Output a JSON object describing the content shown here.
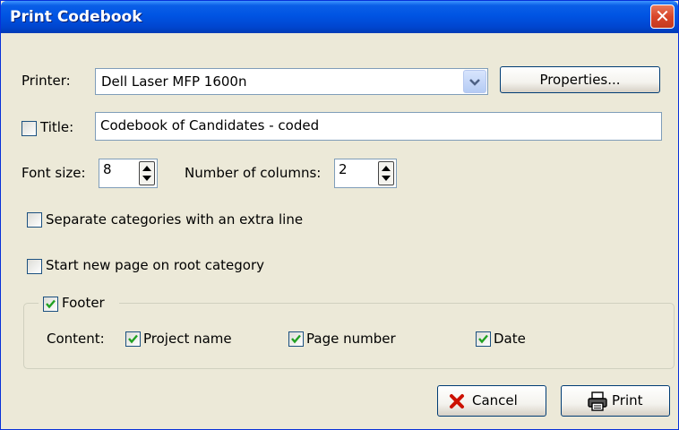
{
  "window": {
    "title": "Print Codebook"
  },
  "printer": {
    "label": "Printer:",
    "selected": "Dell Laser MFP 1600n",
    "properties_label": "Properties..."
  },
  "title_field": {
    "label": "Title:",
    "checked": false,
    "value": "Codebook of Candidates - coded"
  },
  "font_size": {
    "label": "Font size:",
    "value": "8"
  },
  "columns": {
    "label": "Number of columns:",
    "value": "2"
  },
  "options": {
    "separate_label": "Separate categories with an extra line",
    "separate_checked": false,
    "newpage_label": "Start new page on root category",
    "newpage_checked": false
  },
  "footer": {
    "label": "Footer",
    "checked": true,
    "content_label": "Content:",
    "project_name": "Project name",
    "page_number": "Page number",
    "date": "Date"
  },
  "buttons": {
    "cancel": "Cancel",
    "print": "Print"
  },
  "icons": {
    "close": "close-icon",
    "dropdown": "chevron-down-icon",
    "cancel": "x-icon",
    "print": "printer-icon"
  },
  "colors": {
    "titlebar": "#0054e3",
    "dialog": "#ece9d8",
    "close": "#d9462a",
    "check": "#21a121",
    "cancel_x": "#cc1100"
  }
}
